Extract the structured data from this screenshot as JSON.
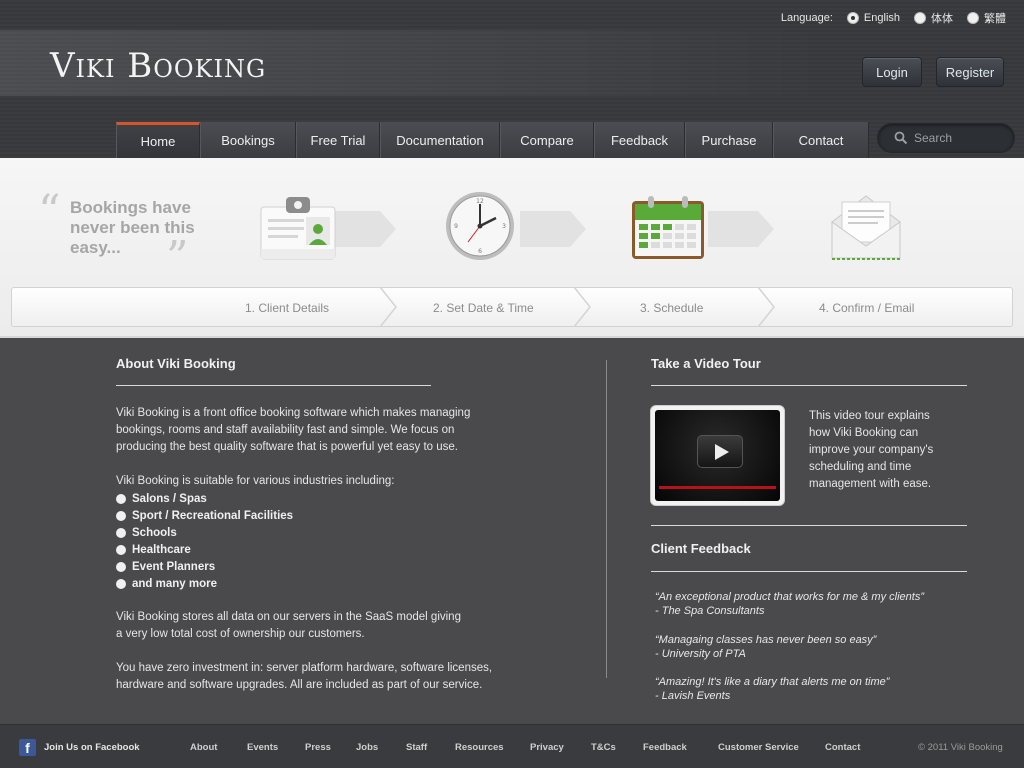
{
  "brand": {
    "logo_text": "Viki Booking"
  },
  "language": {
    "label": "Language:",
    "options": [
      {
        "label": "English",
        "selected": true
      },
      {
        "label": "体体",
        "selected": false
      },
      {
        "label": "繁體",
        "selected": false
      }
    ]
  },
  "auth": {
    "login": "Login",
    "register": "Register"
  },
  "nav": {
    "items": [
      "Home",
      "Bookings",
      "Free Trial",
      "Documentation",
      "Compare",
      "Feedback",
      "Purchase",
      "Contact"
    ],
    "active": "Home"
  },
  "search": {
    "placeholder": "Search"
  },
  "banner": {
    "tagline": "Bookings have never been this easy...",
    "steps": [
      "1. Client Details",
      "2. Set Date & Time",
      "3. Schedule",
      "4. Confirm / Email"
    ]
  },
  "about": {
    "title": "About Viki Booking",
    "intro_lines": [
      "Viki Booking is a front office booking software which makes managing",
      "bookings, rooms and staff availability fast and simple.  We focus on",
      "producing the best quality software that is powerful yet easy to use."
    ],
    "industries_intro": "Viki Booking is suitable for various industries including:",
    "industries": [
      "Salons / Spas",
      "Sport / Recreational Facilities",
      "Schools",
      "Healthcare",
      "Event Planners",
      "and many more"
    ],
    "saas_lines": [
      "Viki Booking stores all data on our servers in the SaaS model giving",
      "a very low total cost of ownership our customers."
    ],
    "investment_lines": [
      "You have zero investment in: server platform hardware, software licenses,",
      "hardware and software upgrades.  All are included as part of our service."
    ]
  },
  "video_tour": {
    "title": "Take a Video Tour",
    "description_lines": [
      "This video tour explains",
      "how Viki Booking can",
      "improve your company's",
      "scheduling and time",
      "management with ease."
    ]
  },
  "client_feedback": {
    "title": "Client Feedback",
    "items": [
      {
        "quote": "“An exceptional product that works for me & my clients”",
        "author": "- The Spa Consultants"
      },
      {
        "quote": "“Managaing classes has never been so easy”",
        "author": "- University of PTA"
      },
      {
        "quote": "“Amazing! It's like a diary that alerts me on time”",
        "author": "- Lavish Events"
      }
    ]
  },
  "footer": {
    "facebook": "Join Us on Facebook",
    "links": [
      "About",
      "Events",
      "Press",
      "Jobs",
      "Staff",
      "Resources",
      "Privacy",
      "T&Cs",
      "Feedback",
      "Customer Service",
      "Contact"
    ],
    "copyright": "© 2011 Viki Booking"
  },
  "colors": {
    "nav_active_accent": "#d5562c",
    "facebook_blue": "#3b5998",
    "icon_green": "#5aaa3a",
    "page_background": "#4a4a4c"
  },
  "icons": [
    "search-icon",
    "id-badge-icon",
    "clock-icon",
    "calendar-icon",
    "envelope-icon",
    "play-icon",
    "facebook-icon"
  ]
}
